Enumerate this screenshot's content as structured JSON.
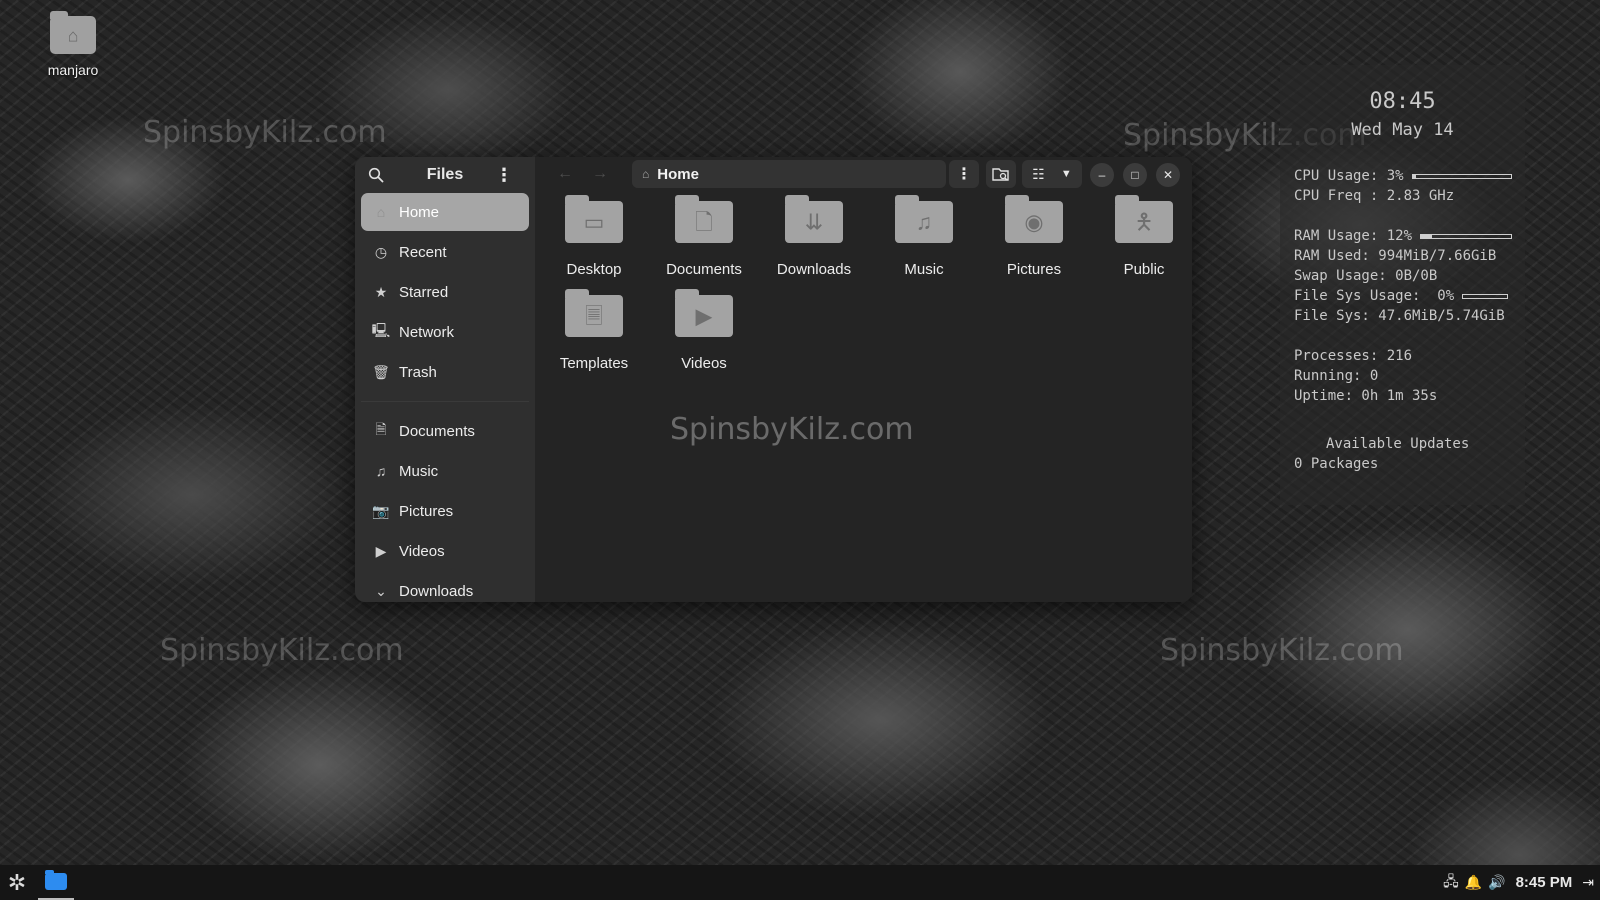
{
  "desktop": {
    "icon_label": "manjaro",
    "watermark": "SpinsbyKilz.com"
  },
  "conky": {
    "time": "08:45",
    "date": "Wed May 14",
    "cpu_usage_label": "CPU Usage: 3%",
    "cpu_usage": 0.03,
    "cpu_freq": "CPU Freq : 2.83 GHz",
    "ram_usage_label": "RAM Usage: 12%",
    "ram_usage": 0.12,
    "ram_used": "RAM Used: 994MiB/7.66GiB",
    "swap_usage": "Swap Usage: 0B/0B",
    "fs_usage_label": "File Sys Usage:  0%",
    "fs_usage": 0.0,
    "fs_sys": "File Sys: 47.6MiB/5.74GiB",
    "processes": "Processes: 216",
    "running": "Running: 0",
    "uptime": "Uptime: 0h 1m 35s",
    "updates_title": "Available Updates",
    "updates_count": "0 Packages"
  },
  "window": {
    "title": "Files",
    "path": "Home",
    "sidebar_top": [
      {
        "label": "Home",
        "icon": "home-icon",
        "active": true
      },
      {
        "label": "Recent",
        "icon": "clock-icon"
      },
      {
        "label": "Starred",
        "icon": "star-icon"
      },
      {
        "label": "Network",
        "icon": "network-icon"
      },
      {
        "label": "Trash",
        "icon": "trash-icon"
      }
    ],
    "sidebar_places": [
      {
        "label": "Documents",
        "icon": "document-icon"
      },
      {
        "label": "Music",
        "icon": "music-icon"
      },
      {
        "label": "Pictures",
        "icon": "camera-icon"
      },
      {
        "label": "Videos",
        "icon": "video-icon"
      },
      {
        "label": "Downloads",
        "icon": "download-icon"
      }
    ],
    "folders": [
      {
        "name": "Desktop",
        "icon": "desktop-folder-icon"
      },
      {
        "name": "Documents",
        "icon": "documents-folder-icon"
      },
      {
        "name": "Downloads",
        "icon": "downloads-folder-icon"
      },
      {
        "name": "Music",
        "icon": "music-folder-icon"
      },
      {
        "name": "Pictures",
        "icon": "pictures-folder-icon"
      },
      {
        "name": "Public",
        "icon": "public-folder-icon"
      },
      {
        "name": "Templates",
        "icon": "templates-folder-icon"
      },
      {
        "name": "Videos",
        "icon": "videos-folder-icon"
      }
    ],
    "watermark": "SpinsbyKilz.com"
  },
  "taskbar": {
    "clock": "8:45 PM",
    "accent": "#2d8cf0"
  }
}
